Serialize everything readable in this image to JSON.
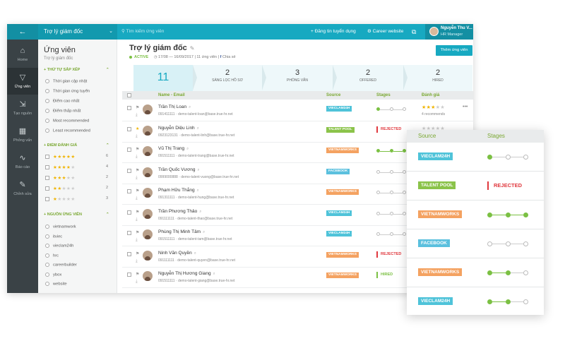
{
  "colors": {
    "accent": "#17a9c1",
    "green": "#7bc043",
    "red": "#e0383e",
    "star": "#f0b400",
    "tag_vieclam24h": "#4fc3d9",
    "tag_talentpool": "#8bc34a",
    "tag_vietnamworks": "#f4a261",
    "tag_facebook": "#5bc0de"
  },
  "topbar": {
    "back_icon": "arrow-left-icon",
    "crumb": "Trợ lý giám đốc",
    "search_placeholder": "Tìm kiếm ứng viên",
    "post_job": "+ Đăng tin tuyển dụng",
    "career_site": "Career website",
    "user_name": "Nguyễn Thu V...",
    "user_role": "HR Manager"
  },
  "nav": [
    {
      "label": "Home",
      "icon": "home-icon",
      "glyph": "⌂"
    },
    {
      "label": "Ứng viên",
      "icon": "filter-icon",
      "glyph": "▽"
    },
    {
      "label": "Tạo nguồn",
      "icon": "source-icon",
      "glyph": "⇲"
    },
    {
      "label": "Phỏng vấn",
      "icon": "calendar-icon",
      "glyph": "▦"
    },
    {
      "label": "Báo cáo",
      "icon": "chart-icon",
      "glyph": "∿"
    },
    {
      "label": "Chỉnh sửa",
      "icon": "edit-icon",
      "glyph": "✎"
    }
  ],
  "filters": {
    "title": "Ứng viên",
    "subtitle": "Trợ lý giám đốc",
    "sort_title": "+ THỨ TỰ SẮP XẾP",
    "sort_options": [
      "Thời gian cập nhật",
      "Thời gian ứng tuyển",
      "Điểm cao nhất",
      "Điểm thấp nhất",
      "Most recommended",
      "Least recommended"
    ],
    "rating_title": "+ ĐIỂM ĐÁNH GIÁ",
    "rating_counts": [
      "6",
      "4",
      "2",
      "2",
      "3"
    ],
    "source_title": "+ NGUỒN ỨNG VIÊN",
    "sources": [
      "vietnamwork",
      "itviec",
      "vieclam24h",
      "hrc",
      "careerbuilder",
      "ybox",
      "website"
    ]
  },
  "job": {
    "title": "Trợ lý giám đốc",
    "status": "ACTIVE",
    "dates": "17/08 — 16/09/2017",
    "applicants": "11 ứng viên",
    "share": "Chia sẻ",
    "add_button": "Thêm ứng viên"
  },
  "pipeline": [
    {
      "count": "11",
      "label": ""
    },
    {
      "count": "2",
      "label": "Sàng lọc hồ sơ"
    },
    {
      "count": "3",
      "label": "Phỏng vấn"
    },
    {
      "count": "2",
      "label": "Offered"
    },
    {
      "count": "2",
      "label": "Hired"
    }
  ],
  "table": {
    "headers": {
      "name": "Name - Email",
      "source": "Source",
      "stages": "Stages",
      "rating": "Đánh giá"
    },
    "rows": [
      {
        "name": "Trần Thị Loan",
        "phone": "091411111",
        "email": "demo-talent-loan@base.true-hr.net",
        "source": "VIECLAM24H",
        "tag": "tag_vieclam24h",
        "stage": 1,
        "rating": 3,
        "reco": "4 recommends"
      },
      {
        "name": "Nguyễn Diệu Linh",
        "phone": "0923123131",
        "email": "demo-talent-linh@base.true-hr.net",
        "source": "TALENT POOL",
        "tag": "tag_talentpool",
        "status": "REJECTED",
        "status_color": "red",
        "rating": 0
      },
      {
        "name": "Vũ Thị Trang",
        "phone": "091511111",
        "email": "demo-talent-trang@base.true-hr.net",
        "source": "VIETNAMWORKS",
        "tag": "tag_vietnamworks",
        "stage": 3
      },
      {
        "name": "Trần Quốc Vương",
        "phone": "0999000888",
        "email": "demo-talent-vuong@base.true-hr.net",
        "source": "FACEBOOK",
        "tag": "tag_facebook"
      },
      {
        "name": "Phạm Hữu Thắng",
        "phone": "091311111",
        "email": "demo-talent-hung@base.true-hr.net",
        "source": "VIETNAMWORKS",
        "tag": "tag_vietnamworks"
      },
      {
        "name": "Trần Phương Thảo",
        "phone": "091111111",
        "email": "demo-talent-thao@base.true-hr.net",
        "source": "VIECLAM24H",
        "tag": "tag_vieclam24h"
      },
      {
        "name": "Phùng Thị Minh Tâm",
        "phone": "091511111",
        "email": "demo-talent-tam@base.true-hr.net",
        "source": "VIECLAM24H",
        "tag": "tag_vieclam24h"
      },
      {
        "name": "Ninh Văn Quyền",
        "phone": "091111111",
        "email": "demo-talent-quyen@base.true-hr.net",
        "source": "VIETNAMWORKS",
        "tag": "tag_vietnamworks",
        "status": "REJECTED",
        "status_color": "red"
      },
      {
        "name": "Nguyễn Thị Hương Giang",
        "phone": "091511111",
        "email": "demo-talent-giang@base.true-hr.net",
        "source": "VIETNAMWORKS",
        "tag": "tag_vietnamworks",
        "status": "HIRED",
        "status_color": "green"
      }
    ]
  },
  "popout": {
    "source_header": "Source",
    "stages_header": "Stages",
    "rows": [
      {
        "source": "VIECLAM24H",
        "tag": "tag_vieclam24h",
        "stage": 1
      },
      {
        "source": "TALENT POOL",
        "tag": "tag_talentpool",
        "status": "REJECTED"
      },
      {
        "source": "VIETNAMWORKS",
        "tag": "tag_vietnamworks",
        "stage": 3
      },
      {
        "source": "FACEBOOK",
        "tag": "tag_facebook"
      },
      {
        "source": "VIETNAMWORKS",
        "tag": "tag_vietnamworks",
        "stage": 2
      },
      {
        "source": "VIECLAM24H",
        "tag": "tag_vieclam24h",
        "stage": 2
      }
    ]
  }
}
